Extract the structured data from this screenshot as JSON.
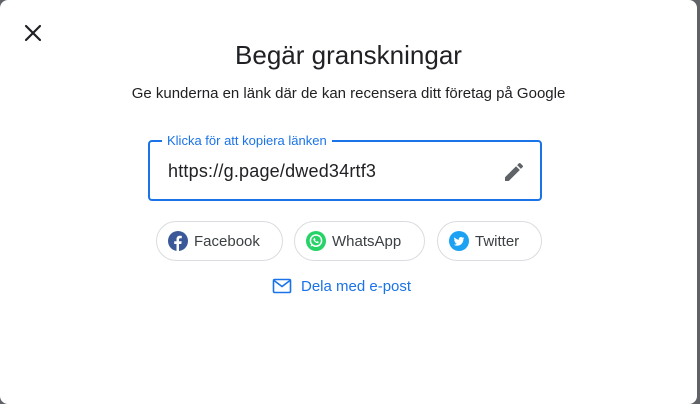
{
  "dialog": {
    "title": "Begär granskningar",
    "subtitle": "Ge kunderna en länk där de kan recensera ditt företag på Google"
  },
  "link_field": {
    "label": "Klicka för att kopiera länken",
    "value": "https://g.page/dwed34rtf3",
    "edit_icon": "pencil-icon"
  },
  "share": {
    "buttons": [
      {
        "label": "Facebook",
        "icon": "facebook-icon",
        "color": "#3b5998"
      },
      {
        "label": "WhatsApp",
        "icon": "whatsapp-icon",
        "color": "#25d366"
      },
      {
        "label": "Twitter",
        "icon": "twitter-icon",
        "color": "#1da1f2"
      }
    ],
    "email_label": "Dela med e-post",
    "email_icon": "mail-icon"
  },
  "colors": {
    "accent": "#1a73e8",
    "text": "#202124",
    "border": "#dadce0"
  }
}
